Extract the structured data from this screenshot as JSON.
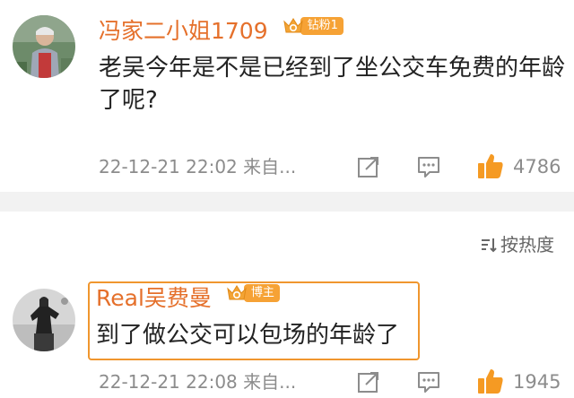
{
  "comments": [
    {
      "username": "冯家二小姐1709",
      "badge": "钻粉1",
      "text": "老吴今年是不是已经到了坐公交车免费的年龄了呢?",
      "time": "22-12-21 22:02 来自...",
      "likes": "4786",
      "avatar_icon": "user-photo-avatar"
    },
    {
      "username": "Real吴费曼",
      "badge": "博主",
      "text": "到了做公交可以包场的年龄了",
      "time": "22-12-21 22:08 来自...",
      "likes": "1945",
      "avatar_icon": "statue-photo-avatar"
    }
  ],
  "sort": {
    "label": "按热度",
    "icon": "sort-icon"
  },
  "colors": {
    "username": "#e5702b",
    "badge_bg": "#f6a235",
    "like_orange": "#f59a23",
    "highlight_border": "#f0962e",
    "meta_gray": "#8c8c8c"
  }
}
